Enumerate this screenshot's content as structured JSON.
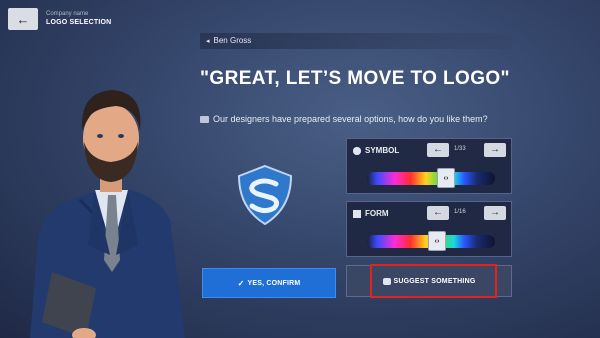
{
  "header": {
    "back_icon": "arrow-left-icon",
    "company_label": "Company name",
    "screen_title": "LOGO SELECTION"
  },
  "dialog": {
    "speaker": "Ben Gross",
    "headline": "\"GREAT, LET’S MOVE TO LOGO\"",
    "message": "Our designers have prepared several options, how do you like them?"
  },
  "symbol_panel": {
    "label": "SYMBOL",
    "counter": "1/33",
    "slider_position": 0.62
  },
  "form_panel": {
    "label": "FORM",
    "counter": "1/16",
    "slider_position": 0.55
  },
  "actions": {
    "confirm_label": "YES, CONFIRM",
    "suggest_label": "SUGGEST SOMETHING"
  },
  "colors": {
    "confirm_button": "#1f6fd6",
    "highlight": "#e2231a",
    "logo_blue": "#3a86d8"
  }
}
